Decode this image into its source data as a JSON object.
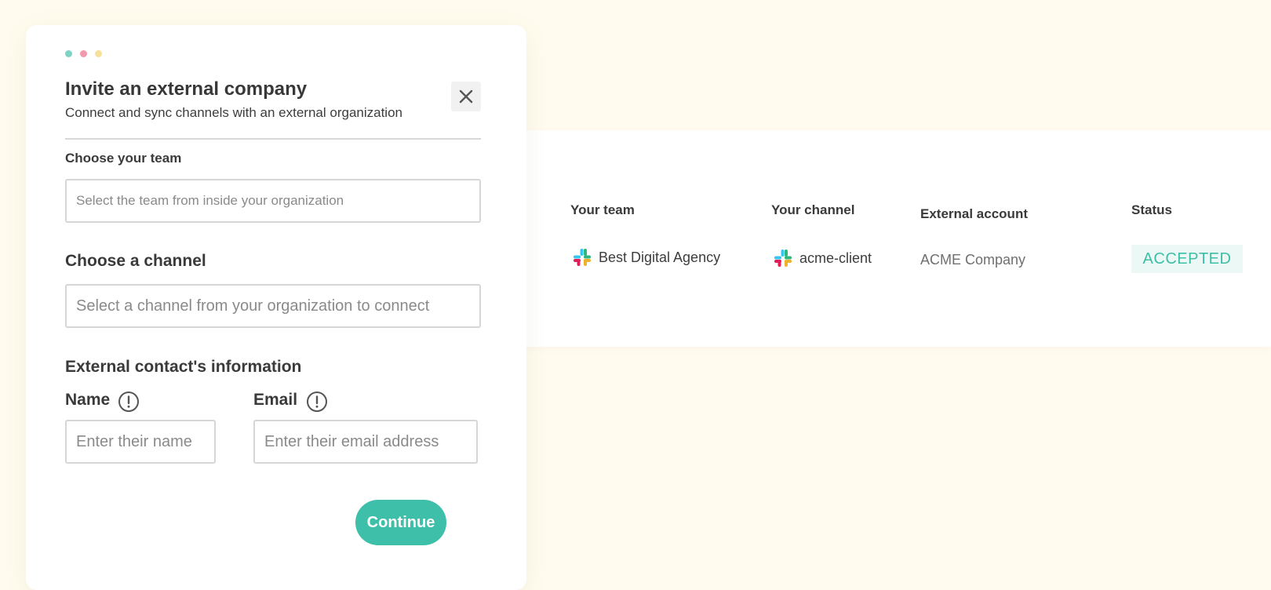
{
  "modal": {
    "title": "Invite an external company",
    "subtitle": "Connect and sync channels with an external organization",
    "team": {
      "label": "Choose your team",
      "placeholder": "Select the team from inside your organization"
    },
    "channel": {
      "label": "Choose a channel",
      "placeholder": "Select a channel from your organization to connect"
    },
    "contact": {
      "heading": "External contact's information",
      "name_label": "Name",
      "name_placeholder": "Enter their name",
      "email_label": "Email",
      "email_placeholder": "Enter their email address"
    },
    "continue_label": "Continue",
    "window_dots": [
      "#7fd3c4",
      "#f29aab",
      "#f7e19a"
    ]
  },
  "table": {
    "headers": {
      "team": "Your team",
      "channel": "Your channel",
      "external": "External account",
      "status": "Status"
    },
    "rows": [
      {
        "team": "Best Digital Agency",
        "channel": "acme-client",
        "external": "ACME Company",
        "status": "ACCEPTED"
      }
    ]
  },
  "colors": {
    "page_background": "#fffbee",
    "accent": "#3dbfa9",
    "status_badge_bg": "#ecf8f5"
  }
}
